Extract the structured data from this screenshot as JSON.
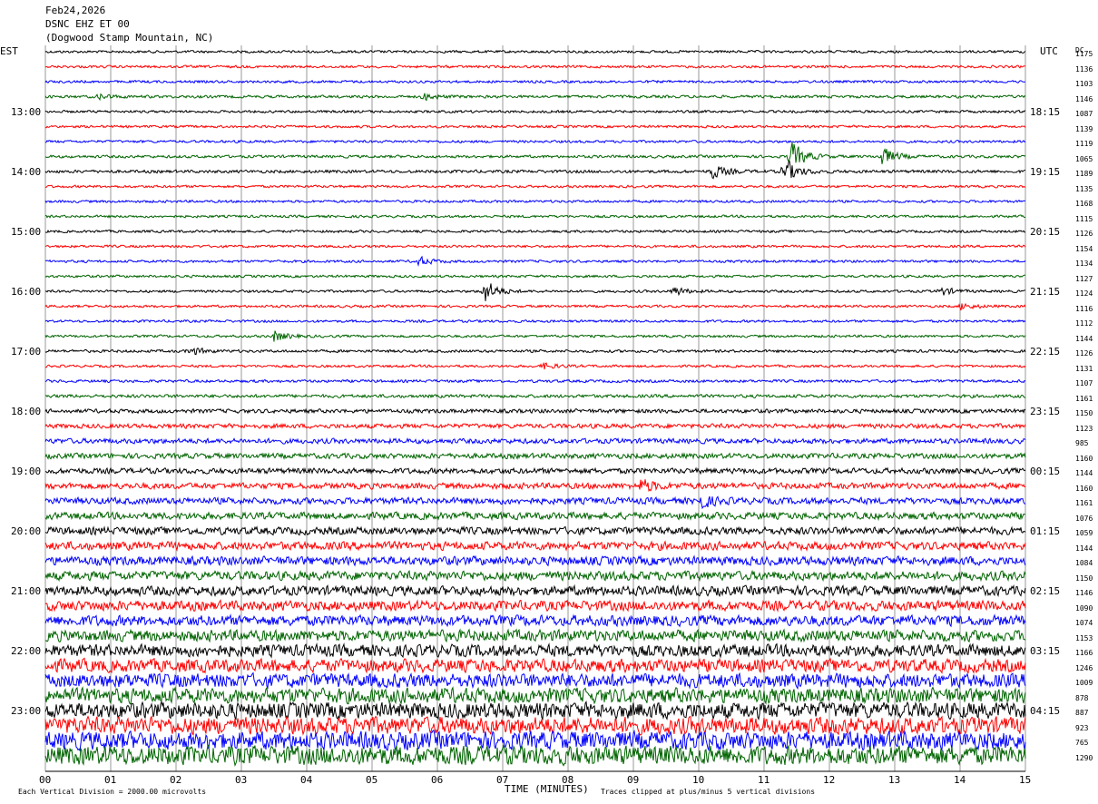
{
  "header": {
    "date": "Feb24,2026",
    "station": "DSNC EHZ ET 00",
    "location": "(Dogwood Stamp Mountain, NC)"
  },
  "tz_left": "EST",
  "tz_right": "UTC",
  "dc_label": "DC",
  "footer": {
    "scale": "Each Vertical Division = 2000.00 microvolts",
    "clip": "Traces clipped at plus/minus 5 vertical divisions"
  },
  "chart_data": {
    "type": "line",
    "xlabel": "TIME (MINUTES)",
    "xlim": [
      0,
      15
    ],
    "x_ticks": [
      "00",
      "01",
      "02",
      "03",
      "04",
      "05",
      "06",
      "07",
      "08",
      "09",
      "10",
      "11",
      "12",
      "13",
      "14",
      "15"
    ],
    "left_hours": [
      "13:00",
      "14:00",
      "15:00",
      "16:00",
      "17:00",
      "18:00",
      "19:00",
      "20:00",
      "21:00",
      "22:00",
      "23:00"
    ],
    "right_hours": [
      "18:15",
      "19:15",
      "20:15",
      "21:15",
      "22:15",
      "23:15",
      "00:15",
      "01:15",
      "02:15",
      "03:15",
      "04:15"
    ],
    "trace_colors": [
      "#000000",
      "#ff0000",
      "#0000ff",
      "#006400"
    ],
    "dc_offsets": [
      1175,
      1136,
      1103,
      1146,
      1087,
      1139,
      1119,
      1065,
      1189,
      1135,
      1168,
      1115,
      1126,
      1154,
      1134,
      1127,
      1124,
      1116,
      1112,
      1144,
      1126,
      1131,
      1107,
      1161,
      1150,
      1123,
      985,
      1160,
      1144,
      1160,
      1161,
      1076,
      1059,
      1144,
      1084,
      1150,
      1146,
      1090,
      1074,
      1153,
      1166,
      1246,
      1009,
      878,
      887,
      923,
      765,
      1290
    ],
    "noise_level": [
      1.0,
      1.0,
      1.0,
      1.1,
      1.0,
      1.0,
      1.0,
      1.1,
      1.2,
      1.0,
      1.0,
      1.0,
      1.0,
      1.0,
      1.0,
      1.0,
      1.0,
      1.0,
      1.0,
      1.0,
      1.1,
      1.0,
      1.1,
      1.3,
      1.6,
      1.8,
      2.0,
      2.1,
      2.2,
      2.4,
      2.6,
      2.8,
      3.0,
      3.3,
      3.5,
      3.6,
      3.8,
      4.0,
      4.2,
      4.5,
      4.8,
      5.2,
      5.6,
      6.0,
      6.4,
      6.8,
      7.2,
      7.6
    ],
    "events": [
      {
        "trace": 3,
        "minute": 0.8,
        "amp": 4
      },
      {
        "trace": 3,
        "minute": 5.8,
        "amp": 5
      },
      {
        "trace": 7,
        "minute": 11.4,
        "amp": 22
      },
      {
        "trace": 7,
        "minute": 12.8,
        "amp": 14
      },
      {
        "trace": 8,
        "minute": 10.2,
        "amp": 10
      },
      {
        "trace": 8,
        "minute": 11.3,
        "amp": 18
      },
      {
        "trace": 14,
        "minute": 5.7,
        "amp": 6
      },
      {
        "trace": 16,
        "minute": 6.7,
        "amp": 18
      },
      {
        "trace": 16,
        "minute": 9.6,
        "amp": 7
      },
      {
        "trace": 16,
        "minute": 13.7,
        "amp": 6
      },
      {
        "trace": 17,
        "minute": 14.0,
        "amp": 5
      },
      {
        "trace": 19,
        "minute": 3.5,
        "amp": 8
      },
      {
        "trace": 20,
        "minute": 2.2,
        "amp": 6
      },
      {
        "trace": 21,
        "minute": 7.6,
        "amp": 5
      },
      {
        "trace": 29,
        "minute": 9.1,
        "amp": 10
      },
      {
        "trace": 30,
        "minute": 10.0,
        "amp": 9
      }
    ]
  }
}
